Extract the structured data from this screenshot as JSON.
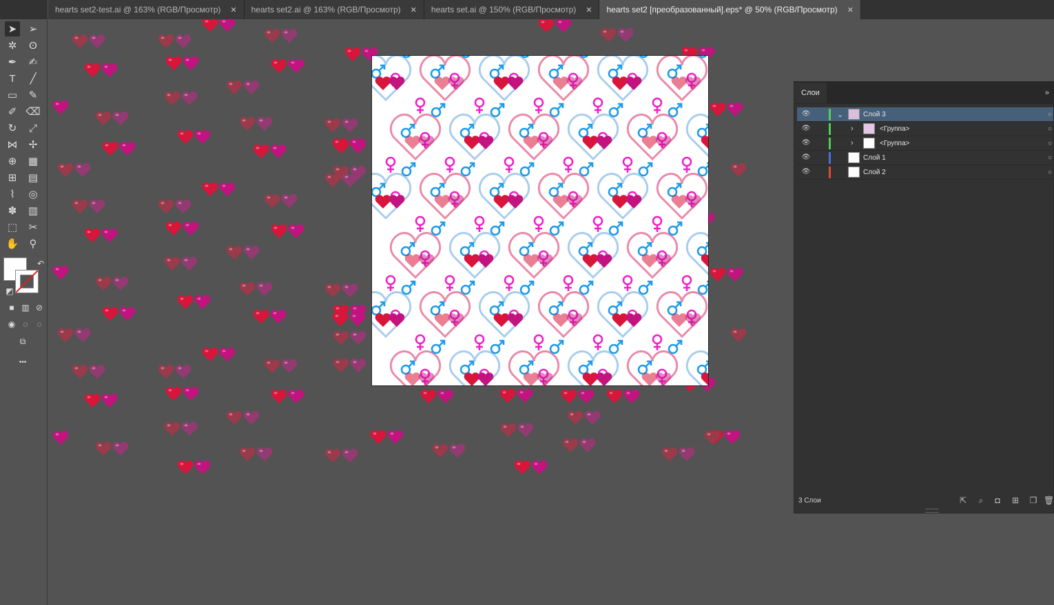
{
  "tabs": [
    {
      "label": "hearts set2-test.ai @ 163% (RGB/Просмотр)",
      "close": "✕",
      "active": false
    },
    {
      "label": "hearts set2.ai @ 163% (RGB/Просмотр)",
      "close": "✕",
      "active": false
    },
    {
      "label": "hearts set.ai @ 150% (RGB/Просмотр)",
      "close": "✕",
      "active": false
    },
    {
      "label": "hearts set2 [преобразованный].eps* @ 50% (RGB/Просмотр)",
      "close": "✕",
      "active": true
    }
  ],
  "toolbar": {
    "tools": [
      "selection-tool",
      "direct-selection-tool",
      "magic-wand-tool",
      "lasso-tool",
      "pen-tool",
      "curvature-tool",
      "type-tool",
      "line-tool",
      "rectangle-tool",
      "paintbrush-tool",
      "shaper-tool",
      "eraser-tool",
      "rotate-tool",
      "scale-tool",
      "width-tool",
      "puppet-warp-tool",
      "shape-builder-tool",
      "perspective-grid-tool",
      "mesh-tool",
      "gradient-tool",
      "eyedropper-tool",
      "blend-tool",
      "symbol-sprayer-tool",
      "column-graph-tool",
      "artboard-tool",
      "slice-tool",
      "hand-tool",
      "zoom-tool"
    ],
    "more_label": "•••"
  },
  "colors": {
    "heart_red": "#d8153a",
    "heart_magenta": "#c2137f",
    "heart_dull_red": "#9a3a4a",
    "heart_dull_magenta": "#943a72",
    "male_blue": "#1c9be8",
    "female_pink": "#f020c8",
    "outline_blue": "#a9cdee",
    "outline_pink": "#ea8aa8",
    "selection_blue": "#46607a"
  },
  "layers_panel": {
    "title": "Слои",
    "collapse": "»",
    "rows": [
      {
        "name": "Слой 3",
        "indent": 0,
        "expanded": true,
        "selected": true,
        "color": "#4fd14f"
      },
      {
        "name": "<Группа>",
        "indent": 1,
        "expanded": false,
        "selected": false,
        "color": "#4fd14f"
      },
      {
        "name": "<Группа>",
        "indent": 1,
        "expanded": false,
        "selected": false,
        "color": "#4fd14f"
      },
      {
        "name": "Слой 1",
        "indent": 0,
        "expanded": false,
        "selected": false,
        "color": "#4a6fe0"
      },
      {
        "name": "Слой 2",
        "indent": 0,
        "expanded": false,
        "selected": false,
        "color": "#e04a3a"
      }
    ],
    "footer": {
      "count": "3 Слои"
    }
  }
}
